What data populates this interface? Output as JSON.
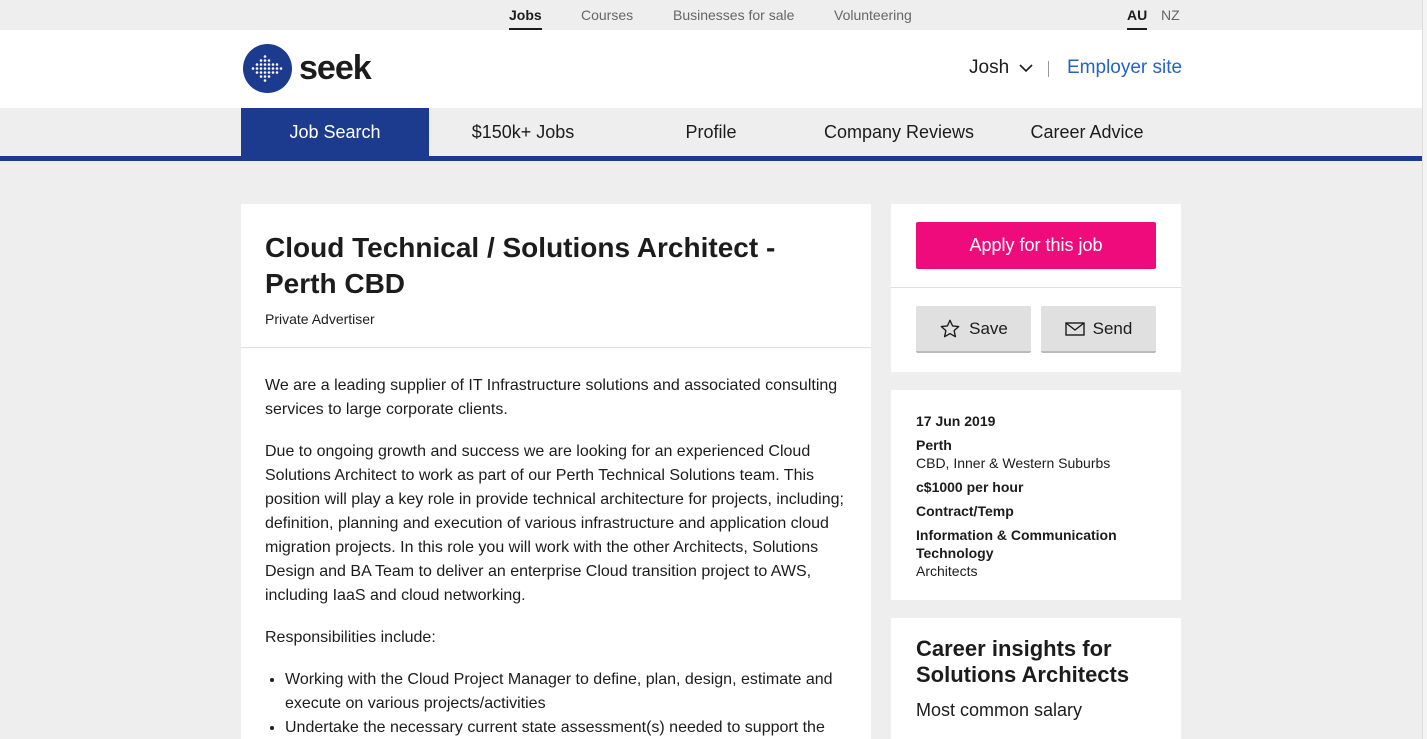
{
  "topbar": {
    "links": [
      "Jobs",
      "Courses",
      "Businesses for sale",
      "Volunteering"
    ],
    "regions": [
      "AU",
      "NZ"
    ]
  },
  "header": {
    "logo_text": "seek",
    "user_name": "Josh",
    "employer_link": "Employer site"
  },
  "nav": {
    "items": [
      "Job Search",
      "$150k+ Jobs",
      "Profile",
      "Company Reviews",
      "Career Advice"
    ]
  },
  "job": {
    "title": "Cloud Technical / Solutions Architect - Perth CBD",
    "advertiser": "Private Advertiser",
    "paragraphs": [
      "We are a leading supplier of IT Infrastructure solutions and associated consulting services to large corporate clients.",
      "Due to ongoing growth and success  we are looking for an experienced Cloud Solutions Architect to work as part of our Perth Technical Solutions team. This position will play a key role in provide technical architecture for projects, including; definition, planning and execution of various infrastructure and application cloud migration projects. In this role you will work with the other Architects, Solutions Design and BA Team to deliver an enterprise Cloud transition project to AWS, including IaaS and cloud networking.",
      "Responsibilities include:"
    ],
    "bullets": [
      "Working with the Cloud Project Manager to define, plan, design, estimate and execute on various  projects/activities",
      "Undertake the necessary current state assessment(s) needed to support the"
    ]
  },
  "actions": {
    "apply": "Apply for this job",
    "save": "Save",
    "send": "Send"
  },
  "details": {
    "date": "17 Jun 2019",
    "location": "Perth",
    "area": "CBD, Inner & Western Suburbs",
    "salary": "c$1000 per hour",
    "work_type": "Contract/Temp",
    "classification": "Information & Communication Technology",
    "sub_classification": "Architects"
  },
  "insights": {
    "title": "Career insights for Solutions Architects",
    "subtitle": "Most common salary"
  },
  "colors": {
    "brand_blue": "#1c3a8e",
    "apply_pink": "#ef0b7c",
    "link_blue": "#2563c8"
  }
}
